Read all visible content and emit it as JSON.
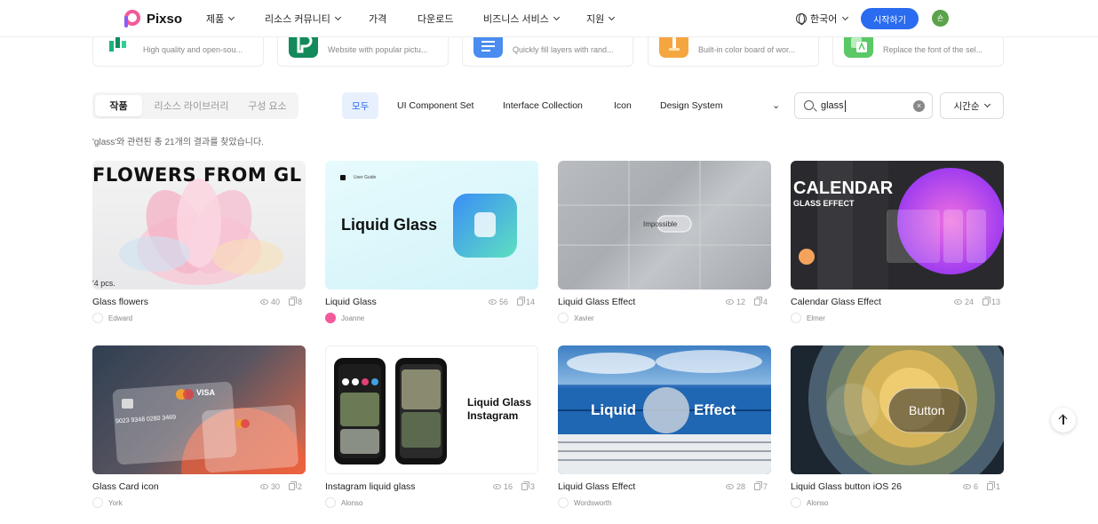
{
  "header": {
    "brand": "Pixso",
    "nav": [
      "제품",
      "리소스 커뮤니티",
      "가격",
      "다운로드",
      "비즈니스 서비스",
      "지원"
    ],
    "nav_dropdown": [
      true,
      true,
      false,
      false,
      true,
      true
    ],
    "language": "한국어",
    "cta": "시작하기",
    "avatar_initial": "숀"
  },
  "plugins": [
    {
      "desc": "High quality and open-sou...",
      "icon_color": "#19b37a"
    },
    {
      "desc": "Website with popular pictu...",
      "icon_color": "#148a5b"
    },
    {
      "desc": "Quickly fill layers with rand...",
      "icon_color": "#4a8cf0"
    },
    {
      "desc": "Built-in color board of wor...",
      "icon_color": "#f5a640"
    },
    {
      "desc": "Replace the font of the sel...",
      "icon_color": "#5ac867"
    }
  ],
  "filters": {
    "segments": [
      "작품",
      "리소스 라이브러리",
      "구성 요소"
    ],
    "categories": [
      "모두",
      "UI Component Set",
      "Interface Collection",
      "Icon",
      "Design System"
    ],
    "search_value": "glass",
    "sort": "시간순"
  },
  "result_text": "'glass'와 관련된 총 21개의 결과를 찾았습니다.",
  "cards": [
    {
      "title": "Glass flowers",
      "views": "40",
      "copies": "8",
      "author": "Edward",
      "thumb_text": "FLOWERS FROM GL",
      "thumb_sub": "'4 pcs."
    },
    {
      "title": "Liquid Glass",
      "views": "56",
      "copies": "14",
      "author": "Joanne",
      "thumb_text": "Liquid Glass",
      "thumb_sub": "User Guide"
    },
    {
      "title": "Liquid Glass Effect",
      "views": "12",
      "copies": "4",
      "author": "Xavier",
      "thumb_text": "Impossible"
    },
    {
      "title": "Calendar Glass Effect",
      "views": "24",
      "copies": "13",
      "author": "Elmer",
      "thumb_text": "CALENDAR",
      "thumb_sub": "GLASS EFFECT"
    },
    {
      "title": "Glass Card icon",
      "views": "30",
      "copies": "2",
      "author": "York",
      "thumb_text": "VISA",
      "thumb_sub": "9023 9348 0280 3469"
    },
    {
      "title": "Instagram liquid glass",
      "views": "16",
      "copies": "3",
      "author": "Alonso",
      "thumb_text": "Liquid Glass Instagram"
    },
    {
      "title": "Liquid Glass Effect",
      "views": "28",
      "copies": "7",
      "author": "Wordsworth",
      "thumb_text": "Liquid",
      "thumb_sub": "Effect"
    },
    {
      "title": "Liquid Glass button iOS 26",
      "views": "6",
      "copies": "1",
      "author": "Alonso",
      "thumb_text": "Button"
    }
  ]
}
